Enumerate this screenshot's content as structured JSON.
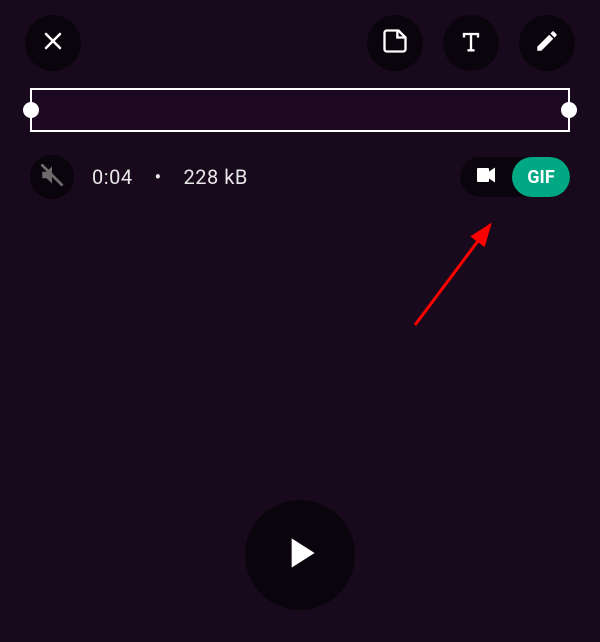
{
  "topbar": {
    "close_label": "Close",
    "sticker_label": "Sticker",
    "text_label": "Text",
    "draw_label": "Draw"
  },
  "trim": {
    "label": "Trim timeline"
  },
  "media": {
    "muted": true,
    "duration": "0:04",
    "separator": "•",
    "size": "228 kB"
  },
  "toggle": {
    "video_label": "Video mode",
    "gif_label": "GIF"
  },
  "playback": {
    "play_label": "Play"
  },
  "colors": {
    "accent": "#00a884"
  }
}
